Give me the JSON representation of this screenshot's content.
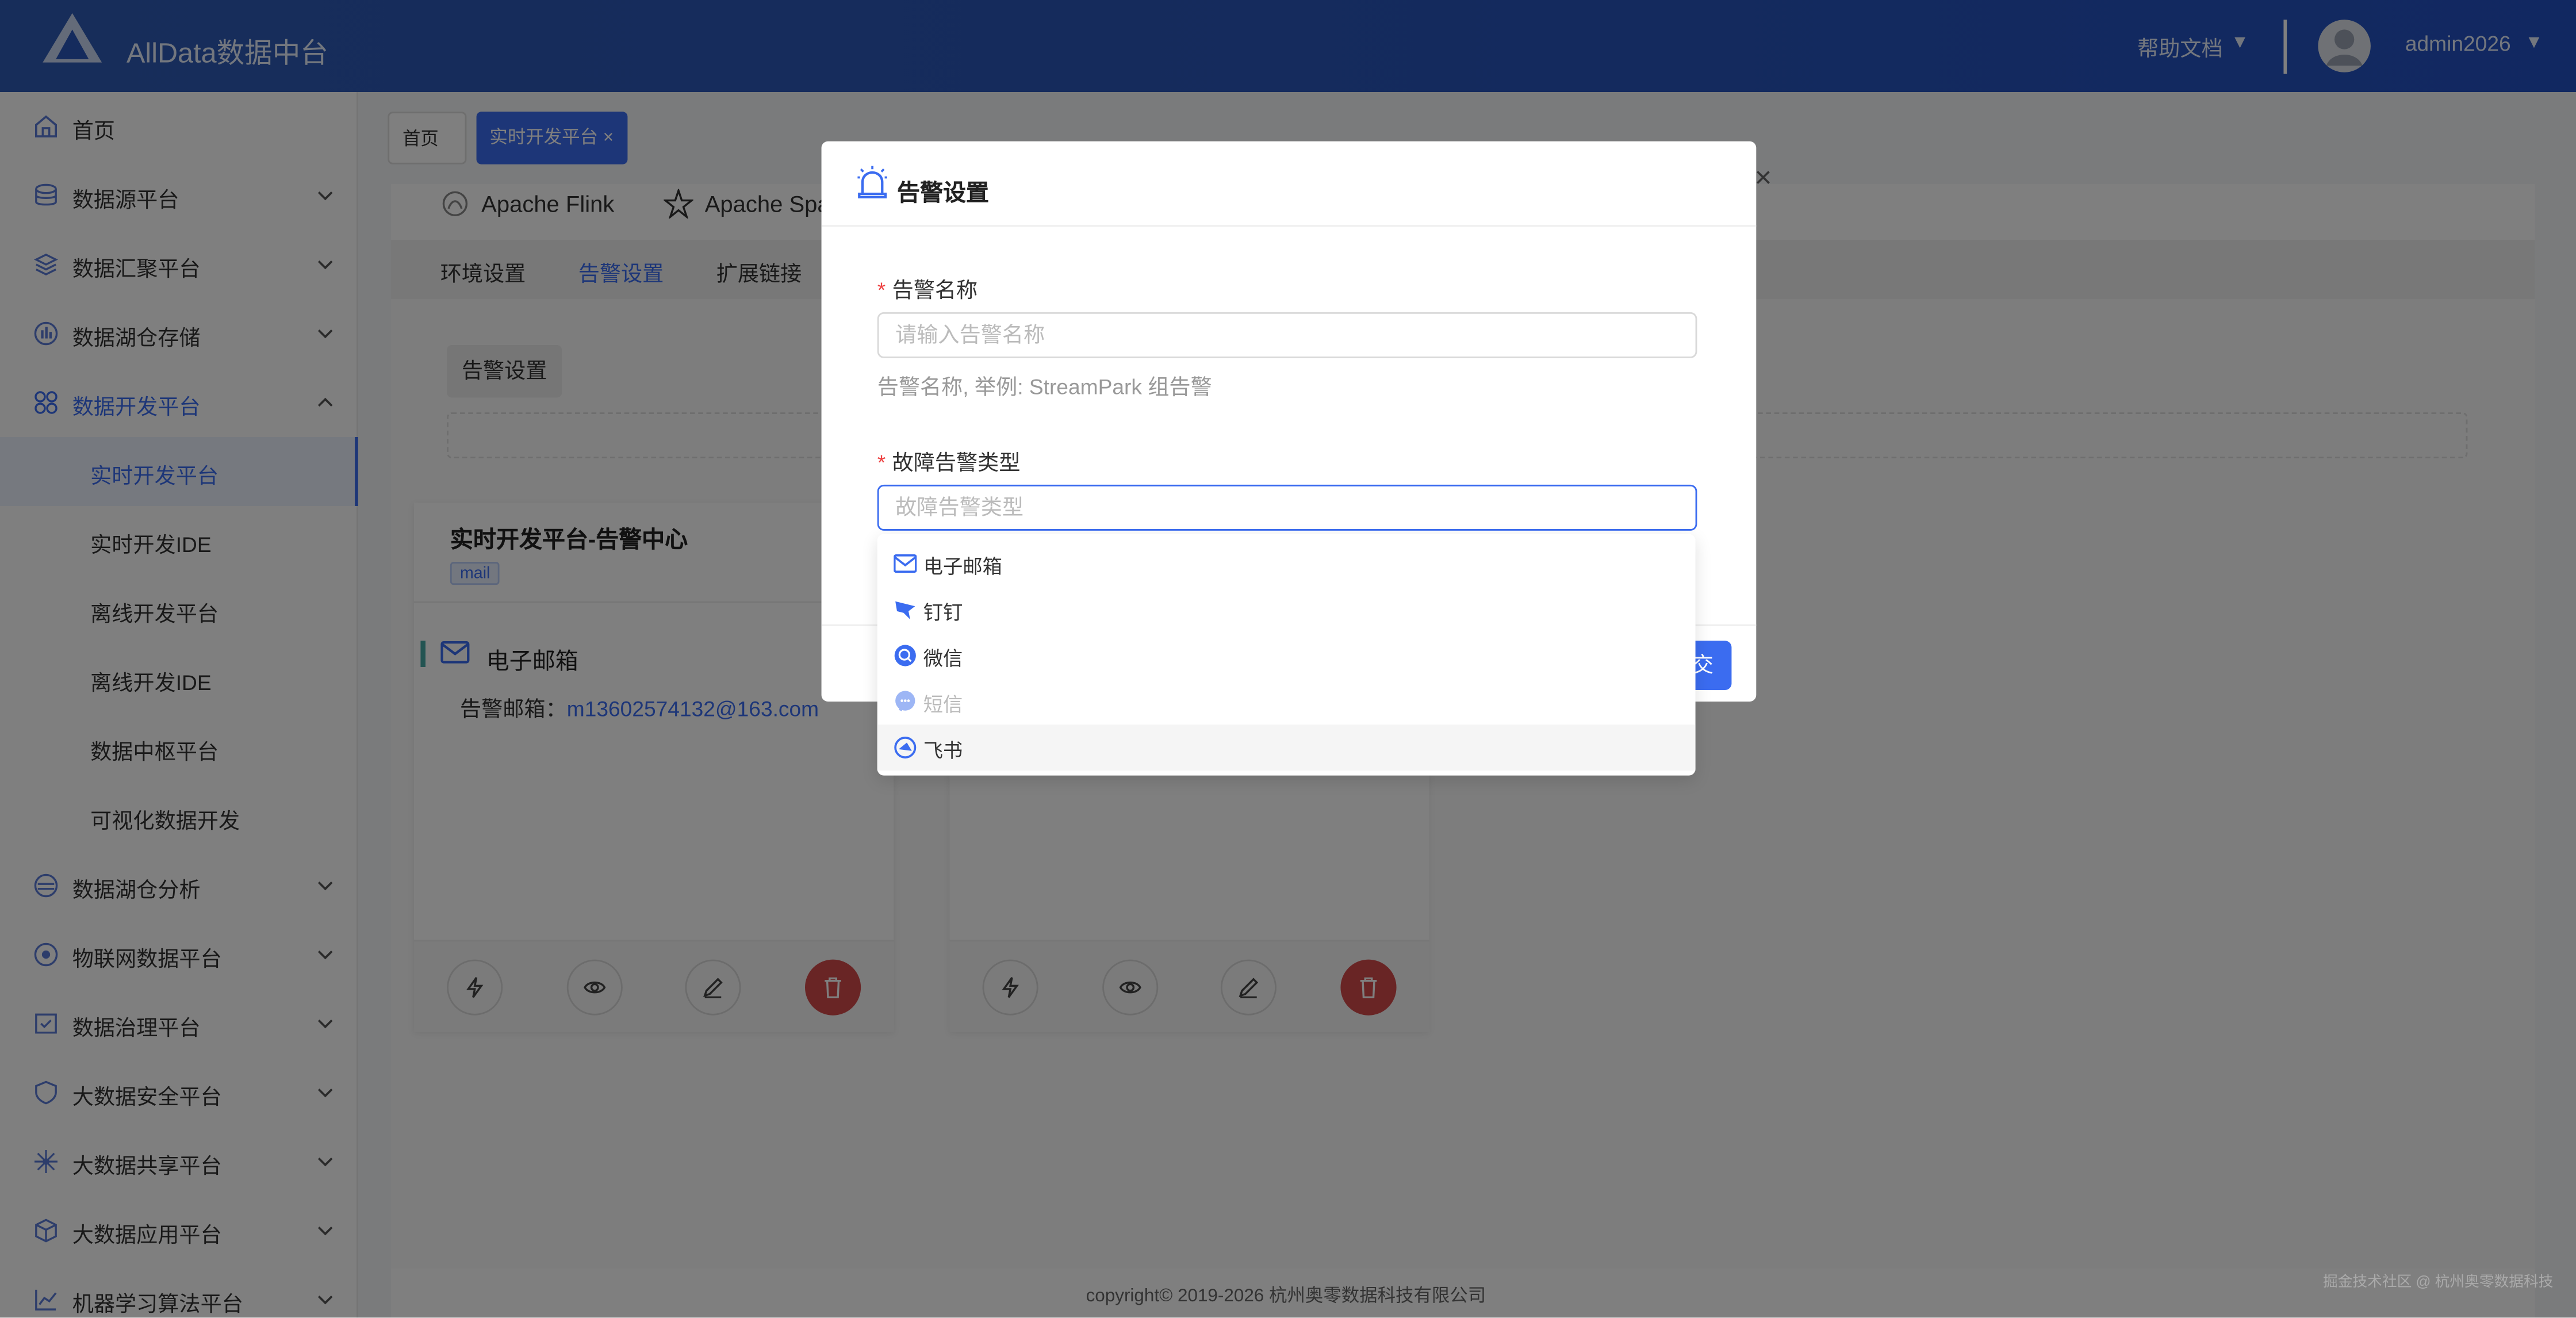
{
  "header": {
    "app_title": "AllData数据中台",
    "help_label": "帮助文档",
    "caret": "▼",
    "user": "admin2026"
  },
  "sidebar": {
    "items": [
      {
        "label": "首页",
        "icon": "home-icon",
        "has_chevron": false
      },
      {
        "label": "数据源平台",
        "icon": "database-icon",
        "has_chevron": true
      },
      {
        "label": "数据汇聚平台",
        "icon": "layers-icon",
        "has_chevron": true
      },
      {
        "label": "数据湖仓存储",
        "icon": "storage-icon",
        "has_chevron": true
      },
      {
        "label": "数据开发平台",
        "icon": "apps-icon",
        "has_chevron": true,
        "active": true
      }
    ],
    "subitems": [
      "实时开发平台",
      "实时开发IDE",
      "离线开发平台",
      "离线开发IDE",
      "数据中枢平台",
      "可视化数据开发"
    ],
    "items_after": [
      {
        "label": "数据湖仓分析",
        "icon": "lake-icon"
      },
      {
        "label": "物联网数据平台",
        "icon": "iot-icon"
      },
      {
        "label": "数据治理平台",
        "icon": "governance-icon"
      },
      {
        "label": "大数据安全平台",
        "icon": "shield-icon"
      },
      {
        "label": "大数据共享平台",
        "icon": "share-icon"
      },
      {
        "label": "大数据应用平台",
        "icon": "cube-icon"
      },
      {
        "label": "机器学习算法平台",
        "icon": "ml-icon"
      }
    ]
  },
  "tabs": {
    "home": "首页",
    "current": "实时开发平台",
    "close": "×"
  },
  "engines": {
    "flink": "Apache Flink",
    "spark": "Apache Spa"
  },
  "subtabs": [
    "环境设置",
    "告警设置",
    "扩展链接"
  ],
  "alarm_button": "告警设置",
  "card": {
    "title": "实时开发平台-告警中心",
    "badge": "mail",
    "channel": "电子邮箱",
    "email_label": "告警邮箱：",
    "email": "m13602574132@163.com"
  },
  "copyright": "copyright© 2019-2026 杭州奥零数据科技有限公司",
  "modal": {
    "title": "告警设置",
    "name_label": "告警名称",
    "name_placeholder": "请输入告警名称",
    "name_help": "告警名称, 举例: StreamPark 组告警",
    "type_label": "故障告警类型",
    "type_placeholder": "故障告警类型",
    "required_mark": "*",
    "submit_partial": "交",
    "close": "×"
  },
  "dropdown": {
    "options": [
      {
        "label": "电子邮箱",
        "icon": "mail-icon",
        "disabled": false
      },
      {
        "label": "钉钉",
        "icon": "dingtalk-icon",
        "disabled": false
      },
      {
        "label": "微信",
        "icon": "wechat-icon",
        "disabled": false
      },
      {
        "label": "短信",
        "icon": "sms-icon",
        "disabled": true
      },
      {
        "label": "飞书",
        "icon": "lark-icon",
        "disabled": false,
        "hover": true
      }
    ]
  },
  "watermark": "掘金技术社区 @ 杭州奥零数据科技",
  "colors": {
    "primary": "#3b6cf0",
    "header": "#2a56ba",
    "danger": "#d34a4a"
  }
}
